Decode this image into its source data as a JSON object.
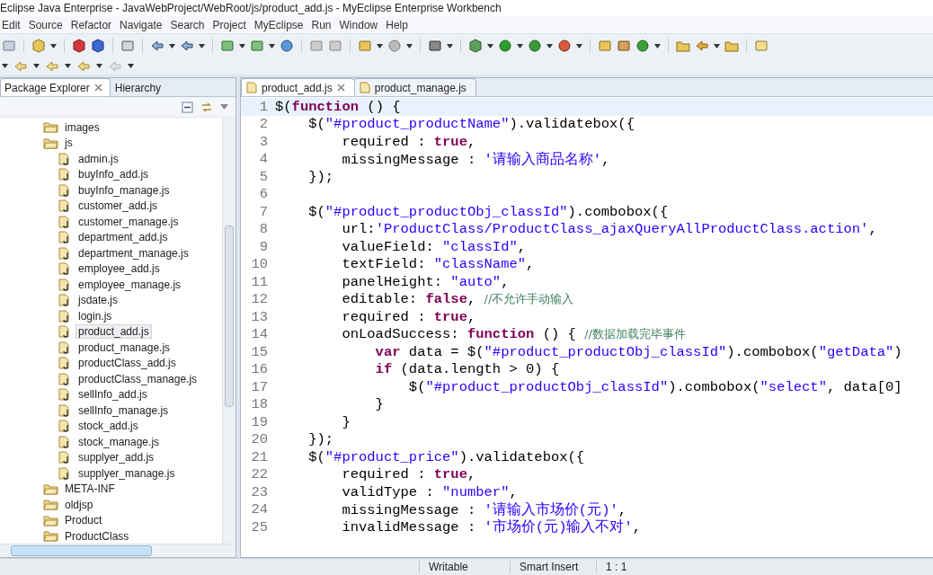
{
  "window": {
    "title": "Eclipse Java Enterprise - JavaWebProject/WebRoot/js/product_add.js - MyEclipse Enterprise Workbench"
  },
  "menu": [
    "Edit",
    "Source",
    "Refactor",
    "Navigate",
    "Search",
    "Project",
    "MyEclipse",
    "Run",
    "Window",
    "Help"
  ],
  "side_tabs": [
    {
      "label": "Package Explorer",
      "selected": true
    },
    {
      "label": "Hierarchy",
      "selected": false
    }
  ],
  "tree": [
    {
      "label": "images",
      "kind": "folder",
      "selected": false
    },
    {
      "label": "js",
      "kind": "folder",
      "selected": false,
      "children": [
        {
          "label": "admin.js",
          "kind": "file",
          "selected": false
        },
        {
          "label": "buyInfo_add.js",
          "kind": "file",
          "selected": false
        },
        {
          "label": "buyInfo_manage.js",
          "kind": "file",
          "selected": false
        },
        {
          "label": "customer_add.js",
          "kind": "file",
          "selected": false
        },
        {
          "label": "customer_manage.js",
          "kind": "file",
          "selected": false
        },
        {
          "label": "department_add.js",
          "kind": "file",
          "selected": false
        },
        {
          "label": "department_manage.js",
          "kind": "file",
          "selected": false
        },
        {
          "label": "employee_add.js",
          "kind": "file",
          "selected": false
        },
        {
          "label": "employee_manage.js",
          "kind": "file",
          "selected": false
        },
        {
          "label": "jsdate.js",
          "kind": "file",
          "selected": false
        },
        {
          "label": "login.js",
          "kind": "file",
          "selected": false
        },
        {
          "label": "product_add.js",
          "kind": "file",
          "selected": true
        },
        {
          "label": "product_manage.js",
          "kind": "file",
          "selected": false
        },
        {
          "label": "productClass_add.js",
          "kind": "file",
          "selected": false
        },
        {
          "label": "productClass_manage.js",
          "kind": "file",
          "selected": false
        },
        {
          "label": "sellInfo_add.js",
          "kind": "file",
          "selected": false
        },
        {
          "label": "sellInfo_manage.js",
          "kind": "file",
          "selected": false
        },
        {
          "label": "stock_add.js",
          "kind": "file",
          "selected": false
        },
        {
          "label": "stock_manage.js",
          "kind": "file",
          "selected": false
        },
        {
          "label": "supplyer_add.js",
          "kind": "file",
          "selected": false
        },
        {
          "label": "supplyer_manage.js",
          "kind": "file",
          "selected": false
        }
      ]
    },
    {
      "label": "META-INF",
      "kind": "folder",
      "selected": false
    },
    {
      "label": "oldjsp",
      "kind": "folder",
      "selected": false
    },
    {
      "label": "Product",
      "kind": "folder",
      "selected": false
    },
    {
      "label": "ProductClass",
      "kind": "folder",
      "selected": false
    }
  ],
  "editor_tabs": [
    {
      "label": "product_add.js",
      "selected": true
    },
    {
      "label": "product_manage.js",
      "selected": false
    }
  ],
  "code": [
    {
      "number": "1",
      "current": true,
      "tokens": [
        {
          "kind": "plain",
          "text": "$("
        },
        {
          "kind": "keyword",
          "text": "function"
        },
        {
          "kind": "plain",
          "text": " () {"
        }
      ]
    },
    {
      "number": "2",
      "current": false,
      "tokens": [
        {
          "kind": "plain",
          "text": "    $("
        },
        {
          "kind": "string",
          "text": "\"#product_productName\""
        },
        {
          "kind": "plain",
          "text": ").validatebox({"
        }
      ]
    },
    {
      "number": "3",
      "current": false,
      "tokens": [
        {
          "kind": "plain",
          "text": "        required : "
        },
        {
          "kind": "keyword",
          "text": "true"
        },
        {
          "kind": "plain",
          "text": ","
        }
      ]
    },
    {
      "number": "4",
      "current": false,
      "tokens": [
        {
          "kind": "plain",
          "text": "        missingMessage : "
        },
        {
          "kind": "string",
          "text": "'请输入商品名称'"
        },
        {
          "kind": "plain",
          "text": ","
        }
      ]
    },
    {
      "number": "5",
      "current": false,
      "tokens": [
        {
          "kind": "plain",
          "text": "    });"
        }
      ]
    },
    {
      "number": "6",
      "current": false
    },
    {
      "number": "7",
      "current": false,
      "tokens": [
        {
          "kind": "plain",
          "text": "    $("
        },
        {
          "kind": "string",
          "text": "\"#product_productObj_classId\""
        },
        {
          "kind": "plain",
          "text": ").combobox({"
        }
      ]
    },
    {
      "number": "8",
      "current": false,
      "tokens": [
        {
          "kind": "plain",
          "text": "        url:"
        },
        {
          "kind": "string",
          "text": "'ProductClass/ProductClass_ajaxQueryAllProductClass.action'"
        },
        {
          "kind": "plain",
          "text": ","
        }
      ]
    },
    {
      "number": "9",
      "current": false,
      "tokens": [
        {
          "kind": "plain",
          "text": "        valueField: "
        },
        {
          "kind": "string",
          "text": "\"classId\""
        },
        {
          "kind": "plain",
          "text": ","
        }
      ]
    },
    {
      "number": "10",
      "current": false,
      "tokens": [
        {
          "kind": "plain",
          "text": "        textField: "
        },
        {
          "kind": "string",
          "text": "\"className\""
        },
        {
          "kind": "plain",
          "text": ","
        }
      ]
    },
    {
      "number": "11",
      "current": false,
      "tokens": [
        {
          "kind": "plain",
          "text": "        panelHeight: "
        },
        {
          "kind": "string",
          "text": "\"auto\""
        },
        {
          "kind": "plain",
          "text": ","
        }
      ]
    },
    {
      "number": "12",
      "current": false,
      "tokens": [
        {
          "kind": "plain",
          "text": "        editable: "
        },
        {
          "kind": "keyword",
          "text": "false"
        },
        {
          "kind": "plain",
          "text": ", "
        },
        {
          "kind": "comment",
          "text": "//不允许手动输入"
        }
      ]
    },
    {
      "number": "13",
      "current": false,
      "tokens": [
        {
          "kind": "plain",
          "text": "        required : "
        },
        {
          "kind": "keyword",
          "text": "true"
        },
        {
          "kind": "plain",
          "text": ","
        }
      ]
    },
    {
      "number": "14",
      "current": false,
      "tokens": [
        {
          "kind": "plain",
          "text": "        onLoadSuccess: "
        },
        {
          "kind": "keyword",
          "text": "function"
        },
        {
          "kind": "plain",
          "text": " () { "
        },
        {
          "kind": "comment",
          "text": "//数据加载完毕事件"
        }
      ]
    },
    {
      "number": "15",
      "current": false,
      "tokens": [
        {
          "kind": "keyword",
          "text": "            var"
        },
        {
          "kind": "plain",
          "text": " data = $("
        },
        {
          "kind": "string",
          "text": "\"#product_productObj_classId\""
        },
        {
          "kind": "plain",
          "text": ").combobox("
        },
        {
          "kind": "string",
          "text": "\"getData\""
        },
        {
          "kind": "plain",
          "text": ")"
        }
      ]
    },
    {
      "number": "16",
      "current": false,
      "tokens": [
        {
          "kind": "keyword",
          "text": "            if"
        },
        {
          "kind": "plain",
          "text": " (data.length > 0) {"
        }
      ]
    },
    {
      "number": "17",
      "current": false,
      "tokens": [
        {
          "kind": "plain",
          "text": "                $("
        },
        {
          "kind": "string",
          "text": "\"#product_productObj_classId\""
        },
        {
          "kind": "plain",
          "text": ").combobox("
        },
        {
          "kind": "string",
          "text": "\"select\""
        },
        {
          "kind": "plain",
          "text": ", data[0]"
        }
      ]
    },
    {
      "number": "18",
      "current": false,
      "tokens": [
        {
          "kind": "plain",
          "text": "            }"
        }
      ]
    },
    {
      "number": "19",
      "current": false,
      "tokens": [
        {
          "kind": "plain",
          "text": "        }"
        }
      ]
    },
    {
      "number": "20",
      "current": false,
      "tokens": [
        {
          "kind": "plain",
          "text": "    });"
        }
      ]
    },
    {
      "number": "21",
      "current": false,
      "tokens": [
        {
          "kind": "plain",
          "text": "    $("
        },
        {
          "kind": "string",
          "text": "\"#product_price\""
        },
        {
          "kind": "plain",
          "text": ").validatebox({"
        }
      ]
    },
    {
      "number": "22",
      "current": false,
      "tokens": [
        {
          "kind": "plain",
          "text": "        required : "
        },
        {
          "kind": "keyword",
          "text": "true"
        },
        {
          "kind": "plain",
          "text": ","
        }
      ]
    },
    {
      "number": "23",
      "current": false,
      "tokens": [
        {
          "kind": "plain",
          "text": "        validType : "
        },
        {
          "kind": "string",
          "text": "\"number\""
        },
        {
          "kind": "plain",
          "text": ","
        }
      ]
    },
    {
      "number": "24",
      "current": false,
      "tokens": [
        {
          "kind": "plain",
          "text": "        missingMessage : "
        },
        {
          "kind": "string",
          "text": "'请输入市场价(元)'"
        },
        {
          "kind": "plain",
          "text": ","
        }
      ]
    },
    {
      "number": "25",
      "current": false,
      "tokens": [
        {
          "kind": "plain",
          "text": "        invalidMessage : "
        },
        {
          "kind": "string",
          "text": "'市场价(元)输入不对'"
        },
        {
          "kind": "plain",
          "text": ","
        }
      ]
    }
  ],
  "status_bar": [
    "Writable",
    "Smart Insert",
    "1 : 1"
  ]
}
